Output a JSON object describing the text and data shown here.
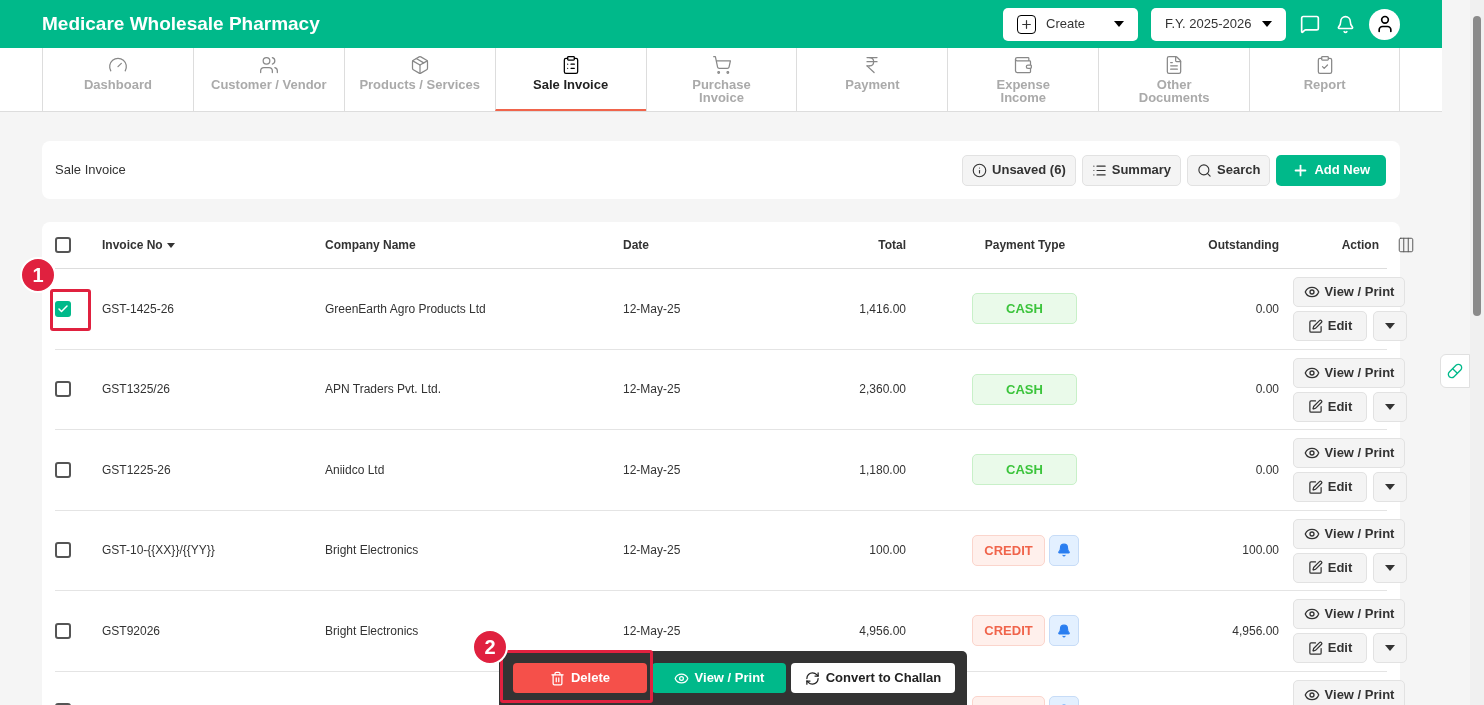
{
  "app_title": "Medicare Wholesale Pharmacy",
  "header": {
    "create_label": "Create",
    "fy_label": "F.Y. 2025-2026"
  },
  "nav_tabs": [
    {
      "label": "Dashboard",
      "selected": false
    },
    {
      "label": "Customer / Vendor",
      "selected": false
    },
    {
      "label": "Products / Services",
      "selected": false
    },
    {
      "label": "Sale Invoice",
      "selected": true
    },
    {
      "label": "Purchase Invoice",
      "selected": false
    },
    {
      "label": "Payment",
      "selected": false
    },
    {
      "label": "Expense Income",
      "selected": false
    },
    {
      "label": "Other Documents",
      "selected": false
    },
    {
      "label": "Report",
      "selected": false
    }
  ],
  "page_header": {
    "title": "Sale Invoice",
    "buttons": [
      {
        "label": "Unsaved (6)",
        "kind": "info"
      },
      {
        "label": "Summary",
        "kind": "summary"
      },
      {
        "label": "Search",
        "kind": "search"
      },
      {
        "label": "Add New",
        "kind": "add"
      }
    ]
  },
  "table": {
    "select_all": {
      "checked": false
    },
    "columns": [
      "Invoice No",
      "Company Name",
      "Date",
      "Total",
      "Payment Type",
      "Outstanding",
      "Action"
    ],
    "rows": [
      {
        "selected": true,
        "invoice_no": "GST-1425-26",
        "company": "GreenEarth Agro Products Ltd",
        "date": "12-May-25",
        "total": "1,416.00",
        "payment": {
          "kind": "cash",
          "label": "CASH"
        },
        "outstanding": "0.00",
        "view_label": "View / Print",
        "edit_label": "Edit"
      },
      {
        "selected": false,
        "invoice_no": "GST1325/26",
        "company": "APN Traders Pvt. Ltd.",
        "date": "12-May-25",
        "total": "2,360.00",
        "payment": {
          "kind": "cash",
          "label": "CASH"
        },
        "outstanding": "0.00",
        "view_label": "View / Print",
        "edit_label": "Edit"
      },
      {
        "selected": false,
        "invoice_no": "GST1225-26",
        "company": "Aniidco Ltd",
        "date": "12-May-25",
        "total": "1,180.00",
        "payment": {
          "kind": "cash",
          "label": "CASH"
        },
        "outstanding": "0.00",
        "view_label": "View / Print",
        "edit_label": "Edit"
      },
      {
        "selected": false,
        "invoice_no": "GST-10-{{XX}}/{{YY}}",
        "company": "Bright Electronics",
        "date": "12-May-25",
        "total": "100.00",
        "payment": {
          "kind": "credit",
          "label": "CREDIT"
        },
        "outstanding": "100.00",
        "view_label": "View / Print",
        "edit_label": "Edit"
      },
      {
        "selected": false,
        "invoice_no": "GST92026",
        "company": "Bright Electronics",
        "date": "12-May-25",
        "total": "4,956.00",
        "payment": {
          "kind": "credit",
          "label": "CREDIT"
        },
        "outstanding": "4,956.00",
        "view_label": "View / Print",
        "edit_label": "Edit"
      },
      {
        "selected": false,
        "payment": {
          "kind": "credit"
        },
        "view_label": "View / Print"
      }
    ]
  },
  "bulk_actions": [
    {
      "label": "Delete",
      "kind": "danger"
    },
    {
      "label": "View / Print",
      "kind": "primary"
    },
    {
      "label": "Convert to Challan",
      "kind": "plain"
    }
  ],
  "annotations": [
    "1",
    "2"
  ]
}
